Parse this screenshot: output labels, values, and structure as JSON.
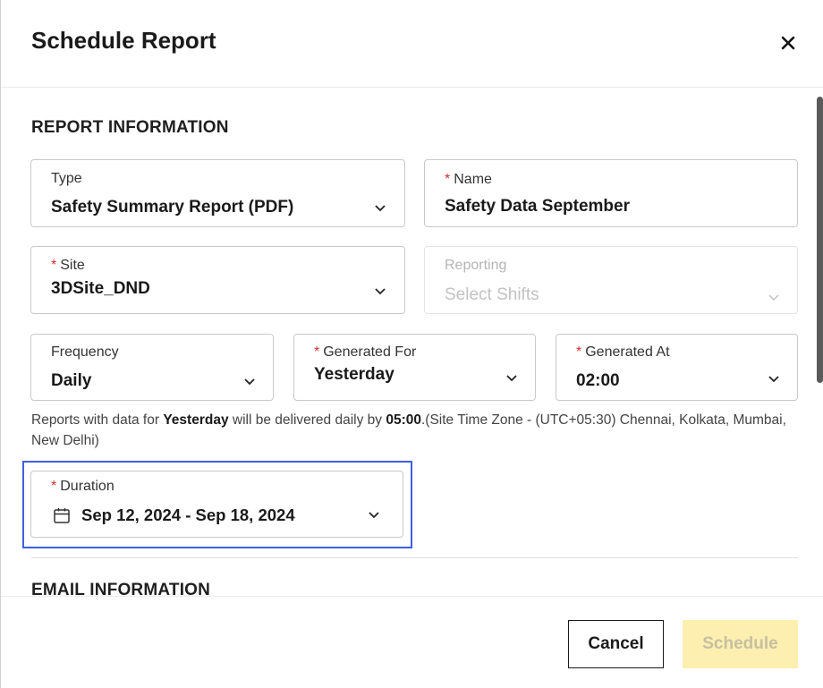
{
  "dialog": {
    "title": "Schedule Report",
    "close_icon": "close-icon"
  },
  "report_info": {
    "heading": "REPORT INFORMATION",
    "type": {
      "label": "Type",
      "value": "Safety Summary Report (PDF)"
    },
    "name": {
      "required": "*",
      "label": "Name",
      "value": "Safety Data September"
    },
    "site": {
      "required": "*",
      "label": "Site",
      "value": "3DSite_DND"
    },
    "reporting": {
      "label": "Reporting",
      "placeholder": "Select Shifts"
    },
    "frequency": {
      "label": "Frequency",
      "value": "Daily"
    },
    "generated_for": {
      "required": "*",
      "label": "Generated For",
      "value": "Yesterday"
    },
    "generated_at": {
      "required": "*",
      "label": "Generated At",
      "value": "02:00"
    },
    "help": {
      "part1": "Reports with data for ",
      "bold1": "Yesterday",
      "part2": " will be delivered daily by ",
      "bold2": "05:00",
      "part3": ".(Site Time Zone - (UTC+05:30) Chennai, Kolkata, Mumbai, New Delhi)"
    },
    "duration": {
      "required": "*",
      "label": "Duration",
      "value": "Sep 12, 2024 - Sep 18, 2024",
      "icon": "calendar-icon"
    }
  },
  "email_info": {
    "heading": "EMAIL INFORMATION"
  },
  "footer": {
    "cancel_label": "Cancel",
    "schedule_label": "Schedule"
  },
  "colors": {
    "accent_highlight": "#3f5fe0",
    "required": "#d32f2f",
    "schedule_disabled_bg": "#fcefb0"
  }
}
